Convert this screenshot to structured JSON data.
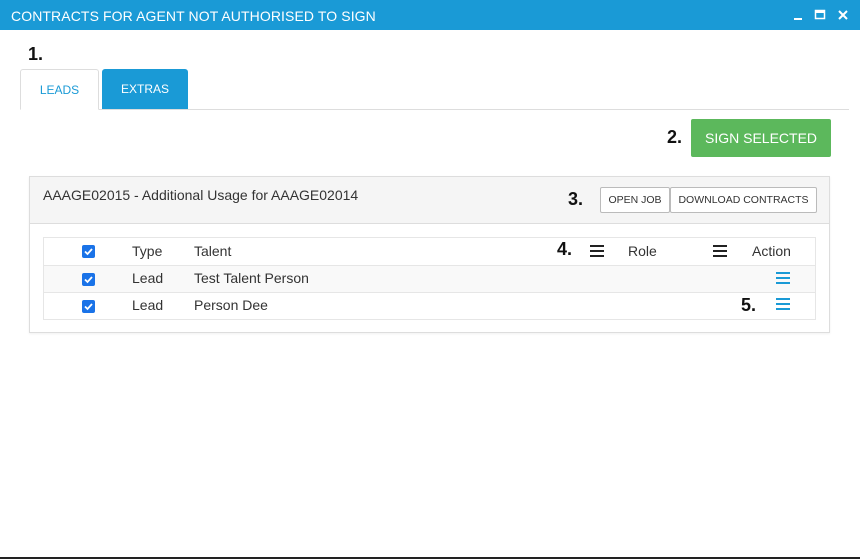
{
  "window": {
    "title": "CONTRACTS FOR AGENT NOT AUTHORISED TO SIGN",
    "controls": [
      "minimize-icon",
      "maximize-icon",
      "close-icon"
    ]
  },
  "annotations": {
    "step1": "1.",
    "step2": "2.",
    "step3": "3.",
    "step4": "4.",
    "step5": "5."
  },
  "tabs": [
    {
      "label": "LEADS",
      "active": true
    },
    {
      "label": "EXTRAS",
      "active": false
    }
  ],
  "actions": {
    "sign_selected": "SIGN SELECTED"
  },
  "panel": {
    "title": "AAAGE02015 - Additional Usage for AAAGE02014",
    "buttons": {
      "open_job": "OPEN JOB",
      "download_contracts": "DOWNLOAD CONTRACTS"
    }
  },
  "table": {
    "headers": {
      "type": "Type",
      "talent": "Talent",
      "role": "Role",
      "action": "Action"
    },
    "header_checked": true,
    "rows": [
      {
        "checked": true,
        "type": "Lead",
        "talent": "Test Talent Person",
        "role": ""
      },
      {
        "checked": true,
        "type": "Lead",
        "talent": "Person Dee",
        "role": ""
      }
    ]
  },
  "colors": {
    "accent": "#1a9ad6",
    "success": "#5cb85c",
    "checkbox": "#1a73e8"
  }
}
